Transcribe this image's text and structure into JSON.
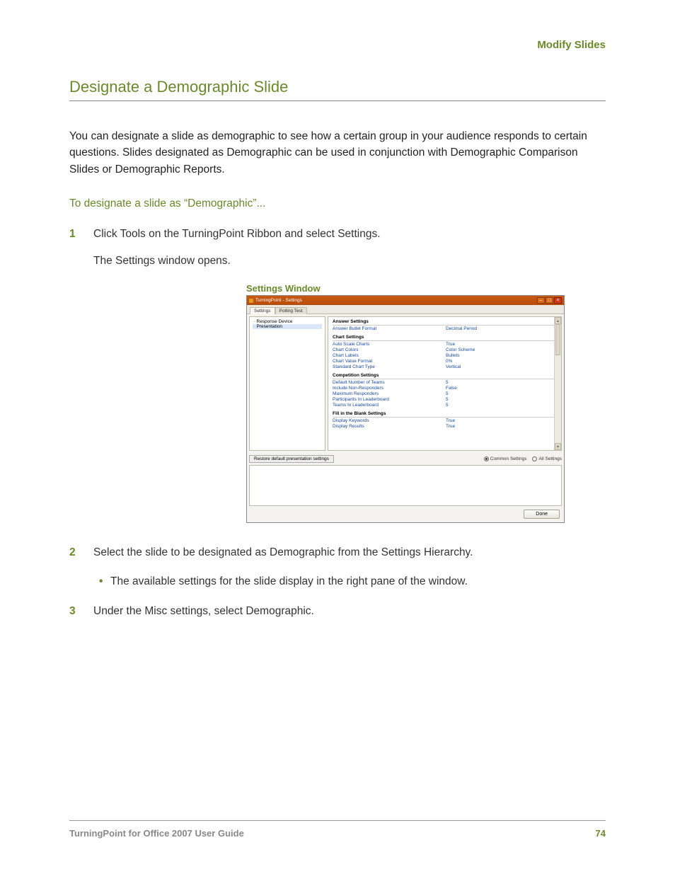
{
  "header": {
    "section_label": "Modify Slides"
  },
  "title": "Designate a Demographic Slide",
  "intro": "You can designate a slide as demographic to see how a certain group in your audience responds to certain questions. Slides designated as Demographic can be used in conjunction with Demographic Comparison Slides or Demographic Reports.",
  "subheading": "To designate a slide as “Demographic”...",
  "steps": {
    "s1": {
      "num": "1",
      "text": "Click Tools on the TurningPoint Ribbon and select Settings."
    },
    "s1_after": "The Settings window opens.",
    "s2": {
      "num": "2",
      "text": "Select the slide to be designated as Demographic from the Settings Hierarchy."
    },
    "s2_bullet": "The available settings for the slide display in the right pane of the window.",
    "s3": {
      "num": "3",
      "text": "Under the Misc settings, select Demographic."
    }
  },
  "figure": {
    "caption": "Settings Window",
    "titlebar": "TurningPoint - Settings",
    "tabs": {
      "t1": "Settings",
      "t2": "Polling Test"
    },
    "tree": {
      "n1": "Response Device",
      "n2": "Presentation"
    },
    "groups": {
      "g1": {
        "head": "Answer Settings",
        "rows": [
          {
            "k": "Answer Bullet Format",
            "v": "Decimal Period"
          }
        ]
      },
      "g2": {
        "head": "Chart Settings",
        "rows": [
          {
            "k": "Auto Scale Charts",
            "v": "True"
          },
          {
            "k": "Chart Colors",
            "v": "Color Scheme"
          },
          {
            "k": "Chart Labels",
            "v": "Bullets"
          },
          {
            "k": "Chart Value Format",
            "v": "0%"
          },
          {
            "k": "Standard Chart Type",
            "v": "Vertical"
          }
        ]
      },
      "g3": {
        "head": "Competition Settings",
        "rows": [
          {
            "k": "Default Number of Teams",
            "v": "5"
          },
          {
            "k": "Include Non-Responders",
            "v": "False"
          },
          {
            "k": "Maximum Responders",
            "v": "5"
          },
          {
            "k": "Participants In Leaderboard",
            "v": "5"
          },
          {
            "k": "Teams In Leaderboard",
            "v": "5"
          }
        ]
      },
      "g4": {
        "head": "Fill in the Blank Settings",
        "rows": [
          {
            "k": "Display Keywords",
            "v": "True"
          },
          {
            "k": "Display Results",
            "v": "True"
          }
        ]
      }
    },
    "restore_btn": "Restore default presentation settings",
    "radios": {
      "r1": "Common Settings",
      "r2": "All Settings"
    },
    "done_btn": "Done"
  },
  "footer": {
    "doc_title": "TurningPoint for Office 2007 User Guide",
    "page_num": "74"
  }
}
